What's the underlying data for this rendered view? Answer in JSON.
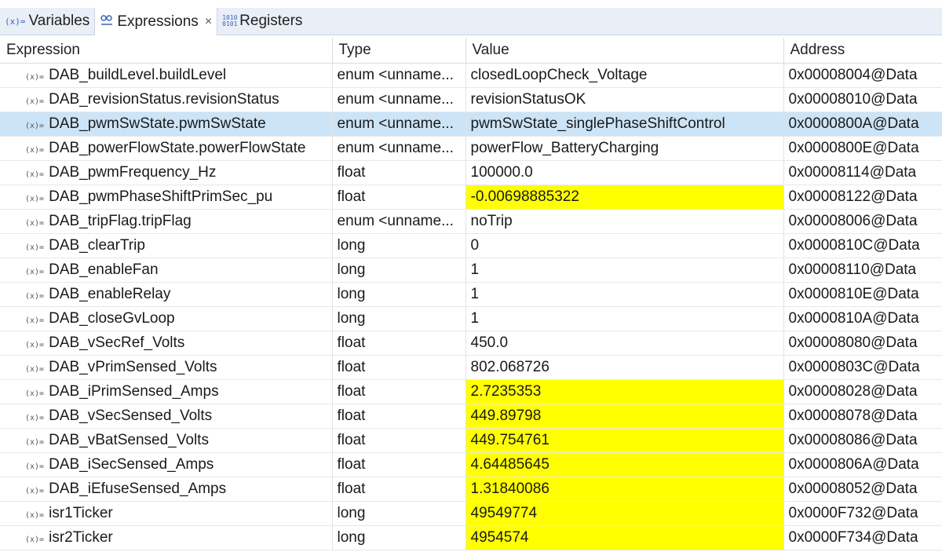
{
  "tabs": [
    {
      "icon": "(x)=",
      "label": "Variables",
      "active": false
    },
    {
      "icon": "66",
      "label": "Expressions",
      "active": true,
      "close": "×"
    },
    {
      "icon": "1010 0101",
      "label": "Registers",
      "active": false
    }
  ],
  "columns": {
    "expression": "Expression",
    "type": "Type",
    "value": "Value",
    "address": "Address"
  },
  "var_icon": "(x)=",
  "highlight_color": "#ffff00",
  "selected_row_color": "#cce4f7",
  "rows": [
    {
      "expression": "DAB_buildLevel.buildLevel",
      "type": "enum <unname...",
      "value": "closedLoopCheck_Voltage",
      "address": "0x00008004@Data",
      "changed": false,
      "selected": false
    },
    {
      "expression": "DAB_revisionStatus.revisionStatus",
      "type": "enum <unname...",
      "value": "revisionStatusOK",
      "address": "0x00008010@Data",
      "changed": false,
      "selected": false
    },
    {
      "expression": "DAB_pwmSwState.pwmSwState",
      "type": "enum <unname...",
      "value": "pwmSwState_singlePhaseShiftControl",
      "address": "0x0000800A@Data",
      "changed": false,
      "selected": true
    },
    {
      "expression": "DAB_powerFlowState.powerFlowState",
      "type": "enum <unname...",
      "value": "powerFlow_BatteryCharging",
      "address": "0x0000800E@Data",
      "changed": false,
      "selected": false
    },
    {
      "expression": "DAB_pwmFrequency_Hz",
      "type": "float",
      "value": "100000.0",
      "address": "0x00008114@Data",
      "changed": false,
      "selected": false
    },
    {
      "expression": "DAB_pwmPhaseShiftPrimSec_pu",
      "type": "float",
      "value": "-0.00698885322",
      "address": "0x00008122@Data",
      "changed": true,
      "selected": false
    },
    {
      "expression": "DAB_tripFlag.tripFlag",
      "type": "enum <unname...",
      "value": "noTrip",
      "address": "0x00008006@Data",
      "changed": false,
      "selected": false
    },
    {
      "expression": "DAB_clearTrip",
      "type": "long",
      "value": "0",
      "address": "0x0000810C@Data",
      "changed": false,
      "selected": false
    },
    {
      "expression": "DAB_enableFan",
      "type": "long",
      "value": "1",
      "address": "0x00008110@Data",
      "changed": false,
      "selected": false
    },
    {
      "expression": "DAB_enableRelay",
      "type": "long",
      "value": "1",
      "address": "0x0000810E@Data",
      "changed": false,
      "selected": false
    },
    {
      "expression": "DAB_closeGvLoop",
      "type": "long",
      "value": "1",
      "address": "0x0000810A@Data",
      "changed": false,
      "selected": false
    },
    {
      "expression": "DAB_vSecRef_Volts",
      "type": "float",
      "value": "450.0",
      "address": "0x00008080@Data",
      "changed": false,
      "selected": false
    },
    {
      "expression": "DAB_vPrimSensed_Volts",
      "type": "float",
      "value": "802.068726",
      "address": "0x0000803C@Data",
      "changed": false,
      "selected": false
    },
    {
      "expression": "DAB_iPrimSensed_Amps",
      "type": "float",
      "value": "2.7235353",
      "address": "0x00008028@Data",
      "changed": true,
      "selected": false
    },
    {
      "expression": "DAB_vSecSensed_Volts",
      "type": "float",
      "value": "449.89798",
      "address": "0x00008078@Data",
      "changed": true,
      "selected": false
    },
    {
      "expression": "DAB_vBatSensed_Volts",
      "type": "float",
      "value": "449.754761",
      "address": "0x00008086@Data",
      "changed": true,
      "selected": false
    },
    {
      "expression": "DAB_iSecSensed_Amps",
      "type": "float",
      "value": "4.64485645",
      "address": "0x0000806A@Data",
      "changed": true,
      "selected": false
    },
    {
      "expression": "DAB_iEfuseSensed_Amps",
      "type": "float",
      "value": "1.31840086",
      "address": "0x00008052@Data",
      "changed": true,
      "selected": false
    },
    {
      "expression": "isr1Ticker",
      "type": "long",
      "value": "49549774",
      "address": "0x0000F732@Data",
      "changed": true,
      "selected": false
    },
    {
      "expression": "isr2Ticker",
      "type": "long",
      "value": "4954574",
      "address": "0x0000F734@Data",
      "changed": true,
      "selected": false
    }
  ]
}
